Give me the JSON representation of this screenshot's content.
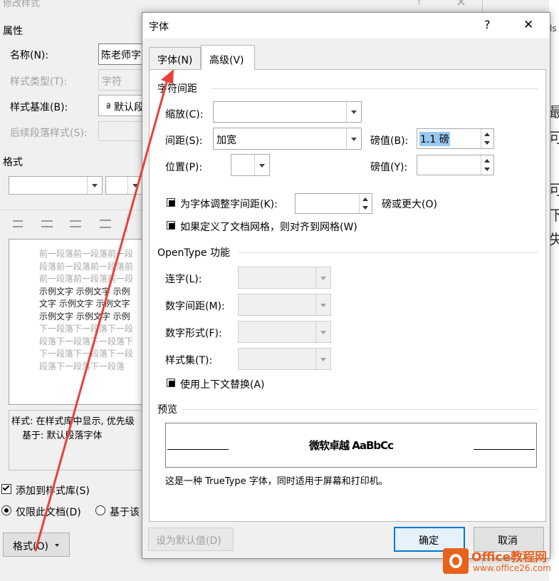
{
  "bg_dialog": {
    "title": "修改样式",
    "title_help": "?",
    "title_close": "×",
    "section_properties": "属性",
    "name_label": "名称(N):",
    "name_value": "陈老师字",
    "style_type_label": "样式类型(T):",
    "style_type_value": "字符",
    "style_based_label": "样式基准(B):",
    "style_based_value": "ª 默认段",
    "next_style_label": "后续段落样式(S):",
    "section_format": "格式",
    "preview_lines": [
      {
        "text": "前一段落前一段落前一段",
        "kind": "gray"
      },
      {
        "text": "段落前一段落前一段落前",
        "kind": "gray"
      },
      {
        "text": "前一段落前一段落前一段",
        "kind": "gray"
      },
      {
        "text": "示例文字 示例文字 示例",
        "kind": "dark"
      },
      {
        "text": "文字 示例文字 示例文字",
        "kind": "dark"
      },
      {
        "text": "示例文字 示例文字 示例",
        "kind": "dark"
      },
      {
        "text": "下一段落下一段落下一段",
        "kind": "gray"
      },
      {
        "text": "段落下一段落下一段落下",
        "kind": "gray"
      },
      {
        "text": "下一段落下一段落下一段",
        "kind": "gray"
      },
      {
        "text": "段落下一段落下一段落",
        "kind": "gray"
      }
    ],
    "desc_line1": "样式: 在样式库中显示, 优先级",
    "desc_line2": "基于: 默认段落字体",
    "add_to_gallery": "添加到样式库(S)",
    "only_this_doc": "仅限此文档(D)",
    "based_on_template": "基于该",
    "format_button": "格式(O)"
  },
  "right_doc": {
    "lines": [
      "最",
      "可",
      "可",
      "下",
      "失"
    ],
    "stub_text": "ls"
  },
  "font_dialog": {
    "title": "字体",
    "help": "?",
    "close": "✕",
    "tabs": [
      {
        "label": "字体(N)",
        "active": false
      },
      {
        "label": "高级(V)",
        "active": true
      }
    ],
    "char_spacing": {
      "section": "字符间距",
      "scale_label": "缩放(C):",
      "scale_value": "",
      "spacing_label": "间距(S):",
      "spacing_value": "加宽",
      "spacing_pt_label": "磅值(B):",
      "spacing_pt_value": "1.1 磅",
      "position_label": "位置(P):",
      "position_value": "",
      "position_pt_label": "磅值(Y):",
      "position_pt_value": "",
      "kerning_label": "为字体调整字间距(K):",
      "kerning_value": "",
      "kerning_suffix": "磅或更大(O)",
      "grid_label": "如果定义了文档网格，则对齐到网格(W)"
    },
    "opentype": {
      "section": "OpenType 功能",
      "ligatures_label": "连字(L):",
      "num_spacing_label": "数字间距(M):",
      "num_forms_label": "数字形式(F):",
      "stylistic_sets_label": "样式集(T):",
      "contextual_label": "使用上下文替换(A)"
    },
    "preview": {
      "section": "预览",
      "sample_text": "微软卓越 AaBbCc",
      "note": "这是一种 TrueType 字体，同时适用于屏幕和打印机。"
    },
    "buttons": {
      "set_default": "设为默认值(D)",
      "ok": "确定",
      "cancel": "取消"
    }
  },
  "watermark": {
    "brand": "Office教程网",
    "url": "www.office26.com"
  },
  "colors": {
    "arrow": "#e8413a",
    "accent": "#0078d7",
    "watermark_orange": "#e8621c"
  }
}
